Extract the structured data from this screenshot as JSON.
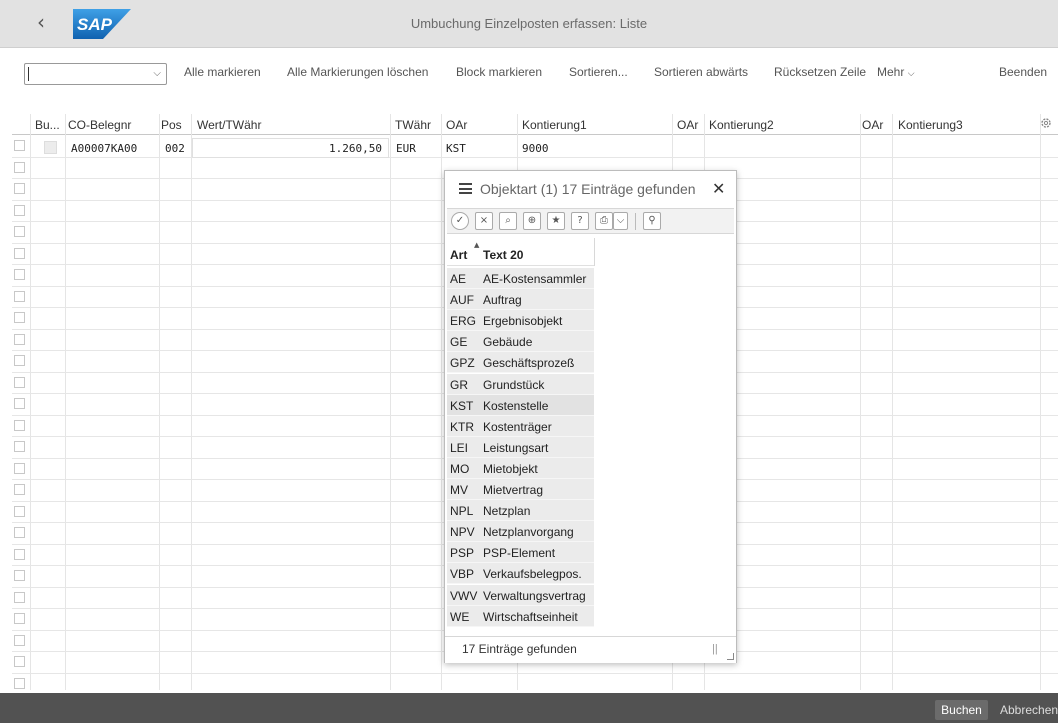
{
  "shell": {
    "title": "Umbuchung Einzelposten erfassen: Liste",
    "logo_text": "SAP",
    "brand_color": "#1f6fb5"
  },
  "toolbar": {
    "select_value": "",
    "buttons": [
      "Alle markieren",
      "Alle Markierungen löschen",
      "Block markieren",
      "Sortieren...",
      "Sortieren abwärts",
      "Rücksetzen Zeile",
      "Mehr",
      "Beenden"
    ]
  },
  "table": {
    "headers": [
      "Bu...",
      "CO-Belegnr",
      "Pos",
      "Wert/TWähr",
      "TWähr",
      "OAr",
      "Kontierung1",
      "OAr",
      "Kontierung2",
      "OAr",
      "Kontierung3"
    ],
    "row": {
      "belegnr": "A00007KA00",
      "pos": "002",
      "wert": "1.260,50",
      "twaehr": "EUR",
      "oar": "KST",
      "kontierung1": "9000"
    }
  },
  "popup": {
    "title": "Objektart (1)  17 Einträge gefunden",
    "col_art": "Art",
    "col_text": "Text 20",
    "items": [
      {
        "code": "AE",
        "text": "AE-Kostensammler"
      },
      {
        "code": "AUF",
        "text": "Auftrag"
      },
      {
        "code": "ERG",
        "text": "Ergebnisobjekt"
      },
      {
        "code": "GE",
        "text": "Gebäude"
      },
      {
        "code": "GPZ",
        "text": "Geschäftsprozeß"
      },
      {
        "code": "GR",
        "text": "Grundstück"
      },
      {
        "code": "KST",
        "text": "Kostenstelle"
      },
      {
        "code": "KTR",
        "text": "Kostenträger"
      },
      {
        "code": "LEI",
        "text": "Leistungsart"
      },
      {
        "code": "MO",
        "text": "Mietobjekt"
      },
      {
        "code": "MV",
        "text": "Mietvertrag"
      },
      {
        "code": "NPL",
        "text": "Netzplan"
      },
      {
        "code": "NPV",
        "text": "Netzplanvorgang"
      },
      {
        "code": "PSP",
        "text": "PSP-Element"
      },
      {
        "code": "VBP",
        "text": "Verkaufsbelegpos."
      },
      {
        "code": "VWV",
        "text": "Verwaltungsvertrag"
      },
      {
        "code": "WE",
        "text": "Wirtschaftseinheit"
      }
    ],
    "selected_code": "KST",
    "footer": "17 Einträge gefunden"
  },
  "footer": {
    "buchen": "Buchen",
    "abbrechen": "Abbrechen"
  }
}
